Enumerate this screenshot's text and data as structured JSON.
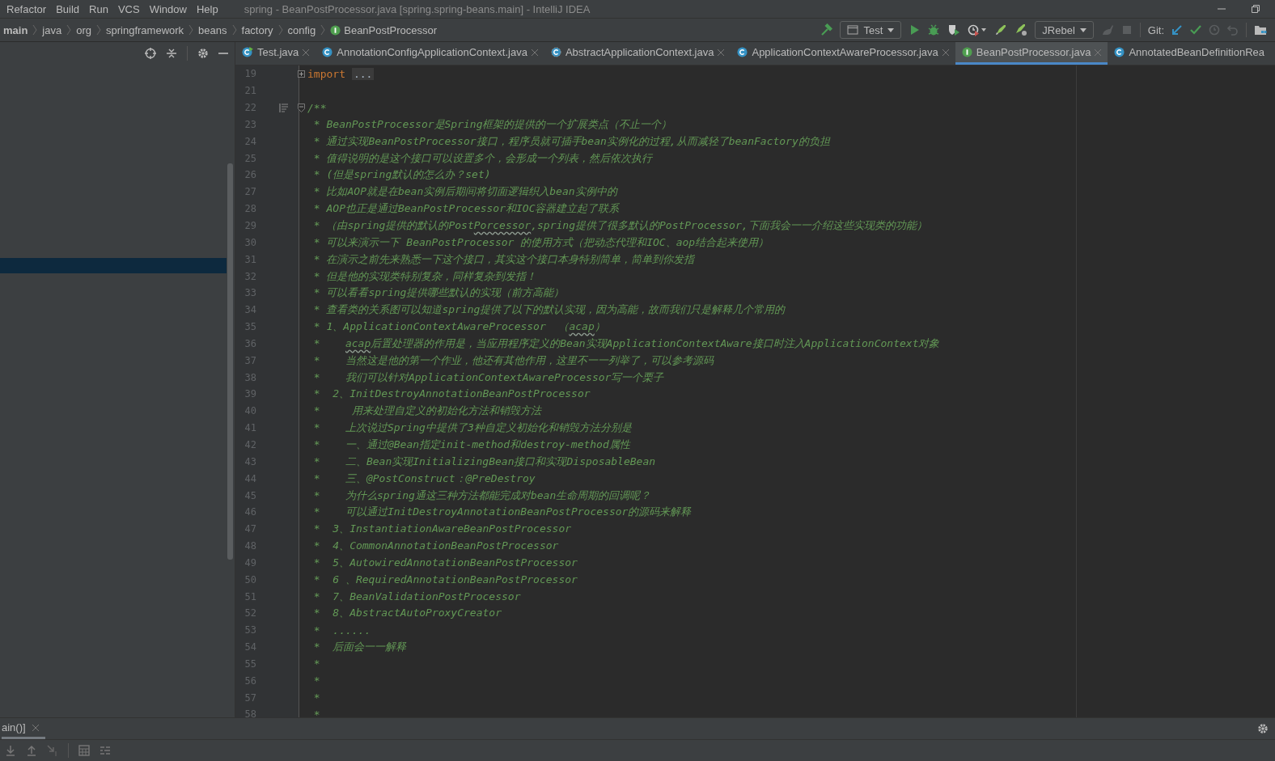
{
  "menu": [
    "Refactor",
    "Build",
    "Run",
    "VCS",
    "Window",
    "Help"
  ],
  "window": {
    "title": "spring - BeanPostProcessor.java [spring.spring-beans.main] - IntelliJ IDEA"
  },
  "breadcrumbs": [
    {
      "label": "main",
      "kind": "module"
    },
    {
      "label": "java",
      "kind": "folder"
    },
    {
      "label": "org",
      "kind": "folder"
    },
    {
      "label": "springframework",
      "kind": "folder"
    },
    {
      "label": "beans",
      "kind": "folder"
    },
    {
      "label": "factory",
      "kind": "folder"
    },
    {
      "label": "config",
      "kind": "folder"
    },
    {
      "label": "BeanPostProcessor",
      "kind": "interface"
    }
  ],
  "toolbar": {
    "run_config": "Test",
    "jrebel": "JRebel",
    "git_label": "Git:"
  },
  "tabs": [
    {
      "label": "Test.java",
      "kind": "runnable",
      "selected": false,
      "closable": true
    },
    {
      "label": "AnnotationConfigApplicationContext.java",
      "kind": "class",
      "selected": false,
      "closable": true
    },
    {
      "label": "AbstractApplicationContext.java",
      "kind": "abstract",
      "selected": false,
      "closable": true
    },
    {
      "label": "ApplicationContextAwareProcessor.java",
      "kind": "class",
      "selected": false,
      "closable": true
    },
    {
      "label": "BeanPostProcessor.java",
      "kind": "interface",
      "selected": true,
      "closable": true
    },
    {
      "label": "AnnotatedBeanDefinitionRea",
      "kind": "class",
      "selected": false,
      "closable": false
    }
  ],
  "lines": [
    {
      "number": "19",
      "kind": "import",
      "keyword": "import",
      "folded": "..."
    },
    {
      "number": "21",
      "kind": "blank"
    },
    {
      "number": "22",
      "kind": "doc-start",
      "text": "/**"
    },
    {
      "number": "23",
      "kind": "comment",
      "text": " * BeanPostProcessor是Spring框架的提供的一个扩展类点（不止一个）"
    },
    {
      "number": "24",
      "kind": "comment",
      "text": " * 通过实现BeanPostProcessor接口，程序员就可插手bean实例化的过程,从而减轻了beanFactory的负担"
    },
    {
      "number": "25",
      "kind": "comment",
      "text": " * 值得说明的是这个接口可以设置多个，会形成一个列表，然后依次执行"
    },
    {
      "number": "26",
      "kind": "comment",
      "text": " * (但是spring默认的怎么办？set)"
    },
    {
      "number": "27",
      "kind": "comment",
      "text": " * 比如AOP就是在bean实例后期间将切面逻辑织入bean实例中的"
    },
    {
      "number": "28",
      "kind": "comment",
      "text": " * AOP也正是通过BeanPostProcessor和IOC容器建立起了联系"
    },
    {
      "number": "29",
      "kind": "comment",
      "parts": [
        {
          "text": " * （由spring提供的默认的Post",
          "typo": false
        },
        {
          "text": "Porcessor",
          "typo": true
        },
        {
          "text": ",spring提供了很多默认的PostProcessor,下面我会一一介绍这些实现类的功能）",
          "typo": false
        }
      ]
    },
    {
      "number": "30",
      "kind": "comment",
      "text": " * 可以来演示一下 BeanPostProcessor 的使用方式（把动态代理和IOC、aop结合起来使用）"
    },
    {
      "number": "31",
      "kind": "comment",
      "text": " * 在演示之前先来熟悉一下这个接口，其实这个接口本身特别简单，简单到你发指"
    },
    {
      "number": "32",
      "kind": "comment",
      "text": " * 但是他的实现类特别复杂，同样复杂到发指！"
    },
    {
      "number": "33",
      "kind": "comment",
      "text": " * 可以看看spring提供哪些默认的实现（前方高能）"
    },
    {
      "number": "34",
      "kind": "comment",
      "text": " * 查看类的关系图可以知道spring提供了以下的默认实现，因为高能，故而我们只是解释几个常用的"
    },
    {
      "number": "35",
      "kind": "comment",
      "parts": [
        {
          "text": " * 1、ApplicationContextAwareProcessor  （",
          "typo": false
        },
        {
          "text": "acap",
          "typo": true
        },
        {
          "text": "）",
          "typo": false
        }
      ]
    },
    {
      "number": "36",
      "kind": "comment",
      "parts": [
        {
          "text": " *    ",
          "typo": false
        },
        {
          "text": "acap",
          "typo": true
        },
        {
          "text": "后置处理器的作用是，当应用程序定义的Bean实现ApplicationContextAware接口时注入ApplicationContext对象",
          "typo": false
        }
      ]
    },
    {
      "number": "37",
      "kind": "comment",
      "text": " *    当然这是他的第一个作业，他还有其他作用，这里不一一列举了，可以参考源码"
    },
    {
      "number": "38",
      "kind": "comment",
      "text": " *    我们可以针对ApplicationContextAwareProcessor写一个栗子"
    },
    {
      "number": "39",
      "kind": "comment",
      "text": " *  2、InitDestroyAnnotationBeanPostProcessor"
    },
    {
      "number": "40",
      "kind": "comment",
      "text": " *     用来处理自定义的初始化方法和销毁方法"
    },
    {
      "number": "41",
      "kind": "comment",
      "text": " *    上次说过Spring中提供了3种自定义初始化和销毁方法分别是"
    },
    {
      "number": "42",
      "kind": "comment",
      "text": " *    一、通过@Bean指定init-method和destroy-method属性"
    },
    {
      "number": "43",
      "kind": "comment",
      "text": " *    二、Bean实现InitializingBean接口和实现DisposableBean"
    },
    {
      "number": "44",
      "kind": "comment",
      "text": " *    三、@PostConstruct：@PreDestroy"
    },
    {
      "number": "45",
      "kind": "comment",
      "text": " *    为什么spring通这三种方法都能完成对bean生命周期的回调呢？"
    },
    {
      "number": "46",
      "kind": "comment",
      "text": " *    可以通过InitDestroyAnnotationBeanPostProcessor的源码来解释"
    },
    {
      "number": "47",
      "kind": "comment",
      "text": " *  3、InstantiationAwareBeanPostProcessor"
    },
    {
      "number": "48",
      "kind": "comment",
      "text": " *  4、CommonAnnotationBeanPostProcessor"
    },
    {
      "number": "49",
      "kind": "comment",
      "text": " *  5、AutowiredAnnotationBeanPostProcessor"
    },
    {
      "number": "50",
      "kind": "comment",
      "text": " *  6 、RequiredAnnotationBeanPostProcessor"
    },
    {
      "number": "51",
      "kind": "comment",
      "text": " *  7、BeanValidationPostProcessor"
    },
    {
      "number": "52",
      "kind": "comment",
      "text": " *  8、AbstractAutoProxyCreator"
    },
    {
      "number": "53",
      "kind": "comment",
      "text": " *  ......"
    },
    {
      "number": "54",
      "kind": "comment",
      "text": " *  后面会一一解释"
    },
    {
      "number": "55",
      "kind": "comment",
      "text": " *"
    },
    {
      "number": "56",
      "kind": "comment",
      "text": " *"
    },
    {
      "number": "57",
      "kind": "comment",
      "text": " *"
    },
    {
      "number": "58",
      "kind": "comment",
      "text": " *"
    }
  ],
  "bottom_panel": {
    "tabs": [
      {
        "label": "ain()]",
        "selected": true
      }
    ]
  }
}
